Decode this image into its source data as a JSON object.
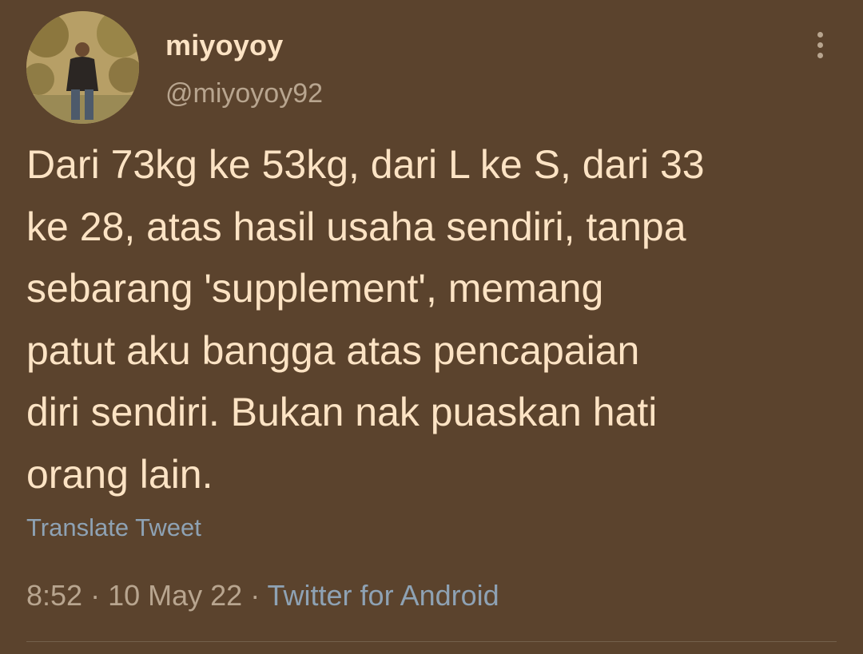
{
  "tweet": {
    "author": {
      "display_name": "miyoyoy",
      "handle": "@miyoyoy92",
      "avatar_icon": "profile-photo"
    },
    "text_lines": [
      "Dari 73kg ke 53kg, dari L ke S, dari 33",
      "ke 28, atas hasil usaha sendiri, tanpa",
      "sebarang 'supplement', memang",
      "patut aku bangga atas pencapaian",
      "diri sendiri. Bukan nak puaskan hati",
      "orang lain."
    ],
    "translate_label": "Translate Tweet",
    "time": "8:52",
    "separator": " · ",
    "date": "10 May 22",
    "source": "Twitter for Android",
    "more_icon": "more-vertical-icon"
  },
  "colors": {
    "background": "#5b432d",
    "text_primary": "#fce3c4",
    "text_secondary": "#b8a58f",
    "link": "#8ea2b4"
  }
}
